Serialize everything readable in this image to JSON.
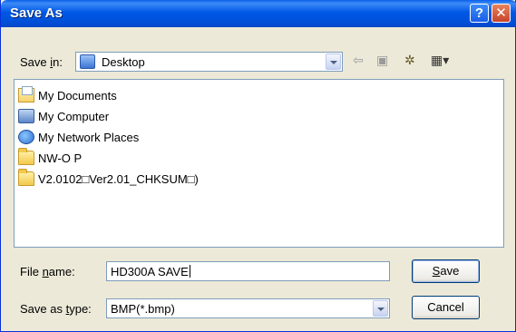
{
  "window": {
    "title": "Save As",
    "help_label": "?",
    "close_label": "✕"
  },
  "save_in": {
    "label_prefix": "Save ",
    "label_accel": "i",
    "label_suffix": "n:",
    "location": "Desktop"
  },
  "toolbar": {
    "back_glyph": "⇦",
    "up_glyph": "▣",
    "new_folder_glyph": "✲",
    "views_glyph": "▦▾"
  },
  "files": [
    {
      "name": "My Documents",
      "icon": "my-documents-icon"
    },
    {
      "name": "My Computer",
      "icon": "my-computer-icon"
    },
    {
      "name": "My Network Places",
      "icon": "network-places-icon"
    },
    {
      "name": "NW-O P",
      "icon": "folder-icon"
    },
    {
      "name": "V2.0102□Ver2.01_CHKSUM□)",
      "icon": "folder-icon"
    }
  ],
  "file_name": {
    "label_prefix": "File ",
    "label_accel": "n",
    "label_suffix": "ame:",
    "value": "HD300A SAVE"
  },
  "save_as_type": {
    "label_prefix": "Save as ",
    "label_accel": "t",
    "label_suffix": "ype:",
    "value": "BMP(*.bmp)"
  },
  "buttons": {
    "save_accel": "S",
    "save_rest": "ave",
    "cancel": "Cancel"
  },
  "colors": {
    "titlebar": "#0058E6",
    "dialog_bg": "#ECE9D8",
    "field_border": "#7F9DB9"
  }
}
